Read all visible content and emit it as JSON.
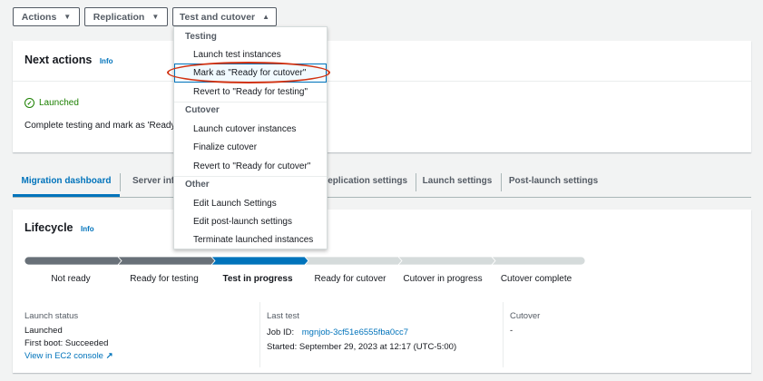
{
  "toolbar": {
    "actions": "Actions",
    "replication": "Replication",
    "test_cutover": "Test and cutover"
  },
  "next_actions": {
    "title": "Next actions",
    "info": "Info",
    "status": "Launched",
    "description": "Complete testing and mark as 'Ready fo"
  },
  "tabs": [
    {
      "label": "Migration dashboard"
    },
    {
      "label": "Server info"
    },
    {
      "label": "Replication settings"
    },
    {
      "label": "Launch settings"
    },
    {
      "label": "Post-launch settings"
    }
  ],
  "lifecycle": {
    "title": "Lifecycle",
    "info": "Info",
    "steps": [
      "Not ready",
      "Ready for testing",
      "Test in progress",
      "Ready for cutover",
      "Cutover in progress",
      "Cutover complete"
    ],
    "current_step": "Test in progress",
    "colors": {
      "done": "#687078",
      "current": "#0073bb",
      "pending": "#d5dbdb"
    }
  },
  "launch_status": {
    "title": "Launch status",
    "value": "Launched",
    "first_boot": "First boot: Succeeded",
    "link": "View in EC2 console"
  },
  "last_test": {
    "title": "Last test",
    "job_label": "Job ID:",
    "job_id": "mgnjob-3cf51e6555fba0cc7",
    "started": "Started: September 29, 2023 at 12:17 (UTC-5:00)"
  },
  "cutover": {
    "title": "Cutover",
    "value": "-"
  },
  "dropdown": {
    "testing_label": "Testing",
    "testing_items": [
      "Launch test instances",
      "Mark as \"Ready for cutover\"",
      "Revert to \"Ready for testing\""
    ],
    "cutover_label": "Cutover",
    "cutover_items": [
      "Launch cutover instances",
      "Finalize cutover",
      "Revert to \"Ready for cutover\""
    ],
    "other_label": "Other",
    "other_items": [
      "Edit Launch Settings",
      "Edit post-launch settings",
      "Terminate launched instances"
    ]
  }
}
